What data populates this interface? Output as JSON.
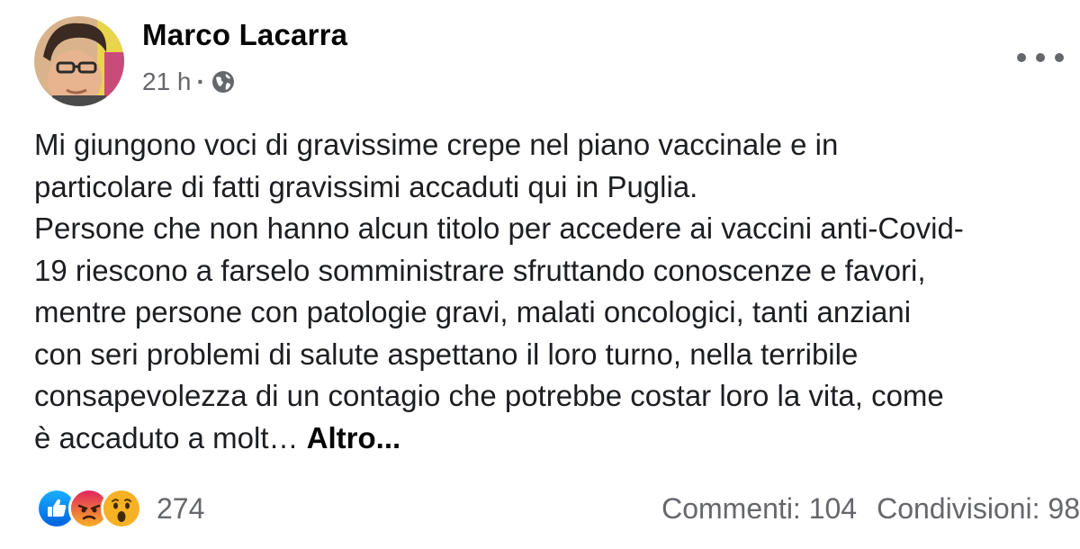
{
  "post": {
    "author": "Marco Lacarra",
    "time": "21 h",
    "separator": "·",
    "privacy_icon": "globe-icon",
    "menu_icon": "more-options-icon",
    "text_lines": [
      "Mi giungono voci di gravissime crepe nel piano vaccinale e in",
      "particolare di fatti gravissimi accaduti qui in Puglia.",
      "Persone che non hanno alcun titolo per accedere ai vaccini anti-Covid-",
      "19 riescono a farselo somministrare sfruttando conoscenze e favori,",
      "mentre persone con patologie gravi, malati oncologici, tanti anziani",
      "con seri problemi di salute aspettano il loro turno, nella terribile",
      "consapevolezza di un contagio che potrebbe costar loro la vita, come",
      "è accaduto a molt…"
    ],
    "see_more": "Altro..."
  },
  "footer": {
    "reactions": [
      {
        "icon": "like-icon",
        "color": "#1877f2"
      },
      {
        "icon": "angry-icon",
        "color": "#e9710f"
      },
      {
        "icon": "wow-icon",
        "color": "#f7b125"
      }
    ],
    "reaction_count": "274",
    "comments": "Commenti: 104",
    "shares": "Condivisioni: 98"
  }
}
